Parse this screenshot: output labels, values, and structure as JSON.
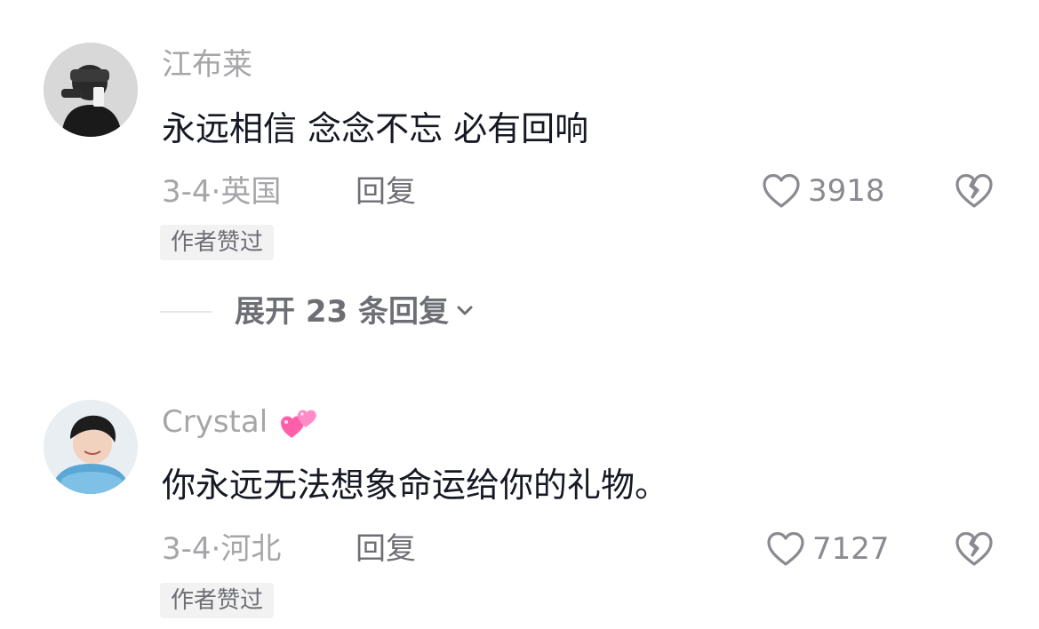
{
  "comments": [
    {
      "username": "江布莱",
      "text": "永远相信 念念不忘 必有回响",
      "date": "3-4",
      "separator": "·",
      "location": "英国",
      "reply_label": "回复",
      "likes": "3918",
      "badge": "作者赞过"
    },
    {
      "username": "Crystal",
      "username_emoji": "two-hearts-emoji",
      "text": "你永远无法想象命运给你的礼物。",
      "date": "3-4",
      "separator": "·",
      "location": "河北",
      "reply_label": "回复",
      "likes": "7127",
      "badge": "作者赞过"
    }
  ],
  "expand_replies": {
    "label": "展开 23 条回复"
  },
  "colors": {
    "text_primary": "#161823",
    "text_secondary": "#a6a6a9",
    "badge_bg": "#f2f2f3",
    "emoji_pink": "#ff5fa8"
  }
}
